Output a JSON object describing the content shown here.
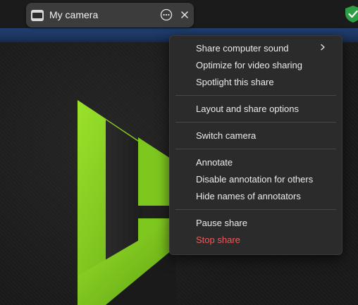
{
  "share_toolbar": {
    "title": "My camera",
    "more_icon": "more-horizontal-icon",
    "close_icon": "close-icon",
    "thumbnail_icon": "camera-thumbnail-icon"
  },
  "security_icon": "shield-check-icon",
  "menu": {
    "items": [
      {
        "label": "Share computer sound",
        "has_submenu": true
      },
      {
        "label": "Optimize for video sharing"
      },
      {
        "label": "Spotlight this share"
      },
      {
        "label": "Layout and share options"
      },
      {
        "label": "Switch camera"
      },
      {
        "label": "Annotate"
      },
      {
        "label": "Disable annotation for others"
      },
      {
        "label": "Hide names of annotators"
      },
      {
        "label": "Pause share"
      },
      {
        "label": "Stop share",
        "style": "danger"
      }
    ],
    "submenu_icon": "chevron-right-icon"
  },
  "colors": {
    "accent_green": "#7dc21e",
    "danger_red": "#ef5b5b",
    "menu_bg": "#2b2b2b",
    "toolbar_bg": "#3c3c3c",
    "shield_green": "#2e9e44"
  }
}
